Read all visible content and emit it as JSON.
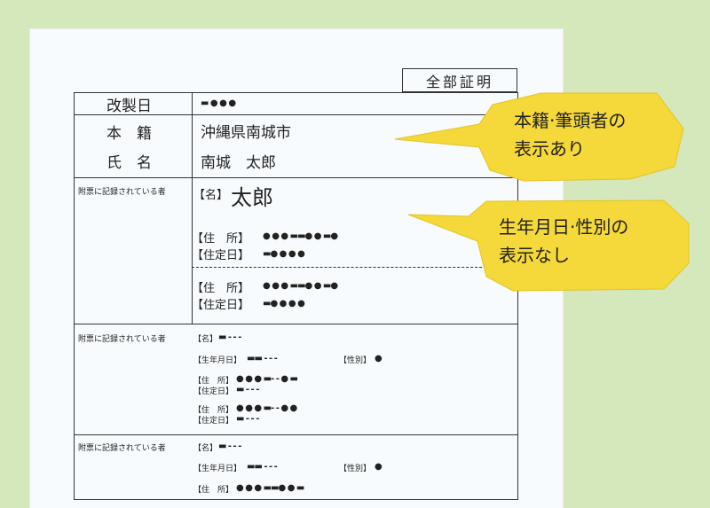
{
  "certificate": {
    "type_label": "全部証明",
    "rows": {
      "revision_label": "改製日",
      "revision_value": "▬ ● ● ●",
      "honseki_label": "本　籍",
      "honseki_value": "沖縄県南城市",
      "name_label": "氏　名",
      "name_value": "南城　太郎"
    },
    "fuhyo_label": "附票に記録されている者",
    "person1": {
      "name_label": "【名】",
      "name_value": "太郎",
      "address_label": "【住　所】",
      "address_value": "● ● ●  ▬▬● ●  ▬●",
      "date_label": "【住定日】",
      "date_value": "▬●  ● ● ●",
      "address2_label": "【住　所】",
      "address2_value": "● ● ●  ▬▬● ●  ▬●",
      "date2_label": "【住定日】",
      "date2_value": "▬●  ● ● ●"
    },
    "person2": {
      "name_label": "【名】",
      "name_value": "▬  ‐ ‐ ‐",
      "birth_label": "【生年月日】",
      "birth_value": "▬▬  ‐ ‐ ‐",
      "sex_label": "【性別】",
      "sex_value": "●",
      "address_label": "【住　所】",
      "address_value": "● ● ●  ▬‐ ‐ ●  ▬",
      "date_label": "【住定日】",
      "date_value": "▬  ‐ ‐ ‐",
      "address2_label": "【住　所】",
      "address2_value": "● ● ●  ▬‐ ‐ ●  ●",
      "date2_label": "【住定日】",
      "date2_value": "▬  ‐ ‐ ‐"
    },
    "person3": {
      "name_label": "【名】",
      "name_value": "▬  ‐ ‐ ‐",
      "birth_label": "【生年月日】",
      "birth_value": "▬▬  ‐ ‐ ‐",
      "sex_label": "【性別】",
      "sex_value": "●",
      "address_label": "【住　所】",
      "address_value": "● ● ●  ▬▬● ●  ▬"
    }
  },
  "callouts": {
    "top_line1": "本籍·筆頭者の",
    "top_line2": "表示あり",
    "bottom_line1": "生年月日·性別の",
    "bottom_line2": "表示なし",
    "fill_color": "#f5d83a"
  }
}
